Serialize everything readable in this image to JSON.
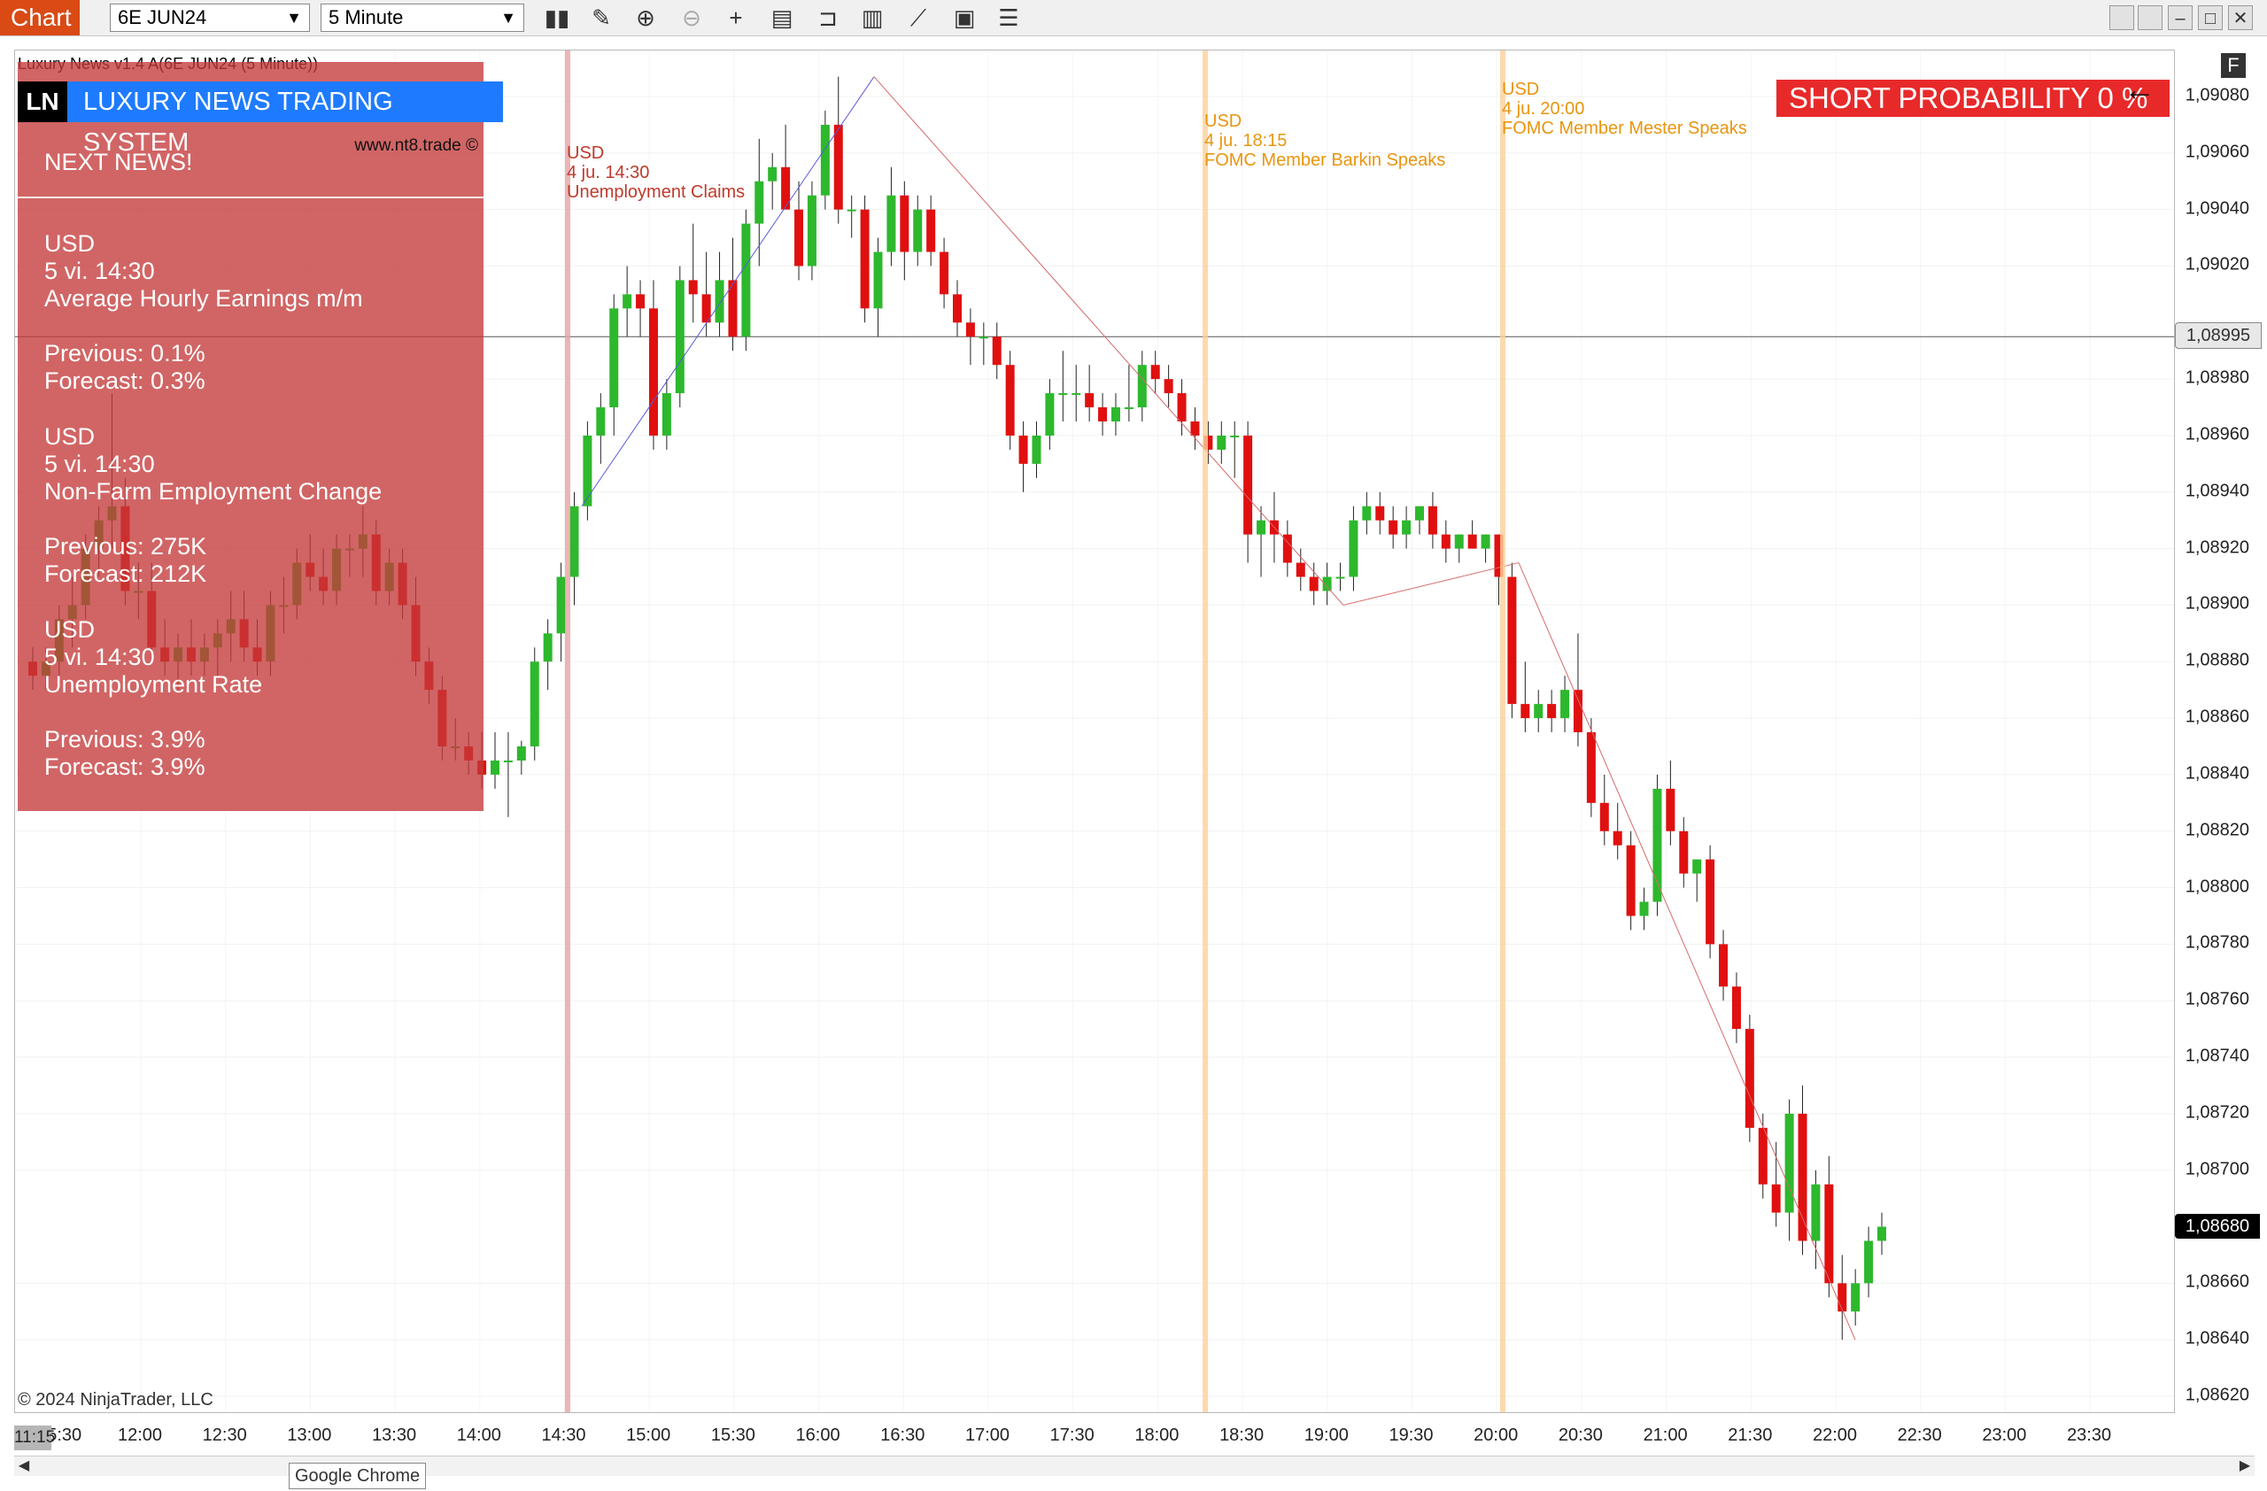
{
  "toolbar": {
    "chart_tab": "Chart",
    "instrument": "6E JUN24",
    "interval": "5 Minute",
    "icons": [
      "bar-type-icon",
      "draw-pencil-icon",
      "zoom-in-icon",
      "zoom-out-icon",
      "crosshair-icon",
      "data-box-icon",
      "order-ticket-icon",
      "strategy-icon",
      "indicator-icon",
      "properties-icon",
      "list-icon"
    ]
  },
  "indicator_title": "Luxury News v1.4 A(6E JUN24 (5 Minute))",
  "news_panel": {
    "logo": "LN",
    "brand": "LUXURY NEWS TRADING SYSTEM",
    "site": "www.nt8.trade ©",
    "next_title": "NEXT NEWS!",
    "items": [
      {
        "currency": "USD",
        "time": "5 vi. 14:30",
        "name": "Average Hourly Earnings m/m",
        "previous": "Previous: 0.1%",
        "forecast": "Forecast: 0.3%"
      },
      {
        "currency": "USD",
        "time": "5 vi. 14:30",
        "name": "Non-Farm Employment Change",
        "previous": "Previous: 275K",
        "forecast": "Forecast: 212K"
      },
      {
        "currency": "USD",
        "time": "5 vi. 14:30",
        "name": "Unemployment Rate",
        "previous": "Previous: 3.9%",
        "forecast": "Forecast: 3.9%"
      }
    ]
  },
  "probability_box": "SHORT PROBABILITY 0 %",
  "news_lines": [
    {
      "currency": "USD",
      "time": "4 ju. 14:30",
      "name": "Unemployment Claims",
      "color": "#c0392b"
    },
    {
      "currency": "USD",
      "time": "4 ju. 18:15",
      "name": "FOMC Member Barkin Speaks",
      "color": "#e8950f"
    },
    {
      "currency": "USD",
      "time": "4 ju. 20:00",
      "name": "FOMC Member Mester Speaks",
      "color": "#e8950f"
    }
  ],
  "chart_data": {
    "type": "candlestick",
    "instrument": "6E JUN24",
    "interval": "5 Minute",
    "y_ticks": [
      "1,09080",
      "1,09060",
      "1,09040",
      "1,09020",
      "1,08980",
      "1,08960",
      "1,08940",
      "1,08920",
      "1,08900",
      "1,08880",
      "1,08860",
      "1,08840",
      "1,08820",
      "1,08800",
      "1,08780",
      "1,08760",
      "1,08740",
      "1,08720",
      "1,08700",
      "1,08660",
      "1,08640",
      "1,08620"
    ],
    "y_range": [
      1.0862,
      1.0908
    ],
    "horizontal_line": "1,08995",
    "last_price": "1,08680",
    "x_ticks": [
      "12:00",
      "12:30",
      "13:00",
      "13:30",
      "14:00",
      "14:30",
      "15:00",
      "15:30",
      "16:00",
      "16:30",
      "17:00",
      "17:30",
      "18:00",
      "18:30",
      "19:00",
      "19:30",
      "20:00",
      "20:30",
      "21:00",
      "21:30",
      "22:00",
      "22:30",
      "23:00",
      "23:30"
    ],
    "x_first_label": "11:15:30",
    "up_color": "#2db82d",
    "down_color": "#e01010",
    "candles": [
      [
        1.0888,
        1.08885,
        1.0887,
        1.08875
      ],
      [
        1.08875,
        1.08885,
        1.0887,
        1.0888
      ],
      [
        1.0888,
        1.089,
        1.0887,
        1.08895
      ],
      [
        1.08895,
        1.0891,
        1.08885,
        1.089
      ],
      [
        1.089,
        1.08925,
        1.08895,
        1.0892
      ],
      [
        1.0892,
        1.08935,
        1.0891,
        1.0893
      ],
      [
        1.0893,
        1.08975,
        1.0892,
        1.08935
      ],
      [
        1.08935,
        1.08945,
        1.089,
        1.08905
      ],
      [
        1.08905,
        1.08915,
        1.08895,
        1.08905
      ],
      [
        1.08905,
        1.08915,
        1.0888,
        1.08885
      ],
      [
        1.08885,
        1.08895,
        1.08875,
        1.0888
      ],
      [
        1.0888,
        1.0889,
        1.0887,
        1.08885
      ],
      [
        1.08885,
        1.08895,
        1.08875,
        1.0888
      ],
      [
        1.0888,
        1.0889,
        1.08875,
        1.08885
      ],
      [
        1.08885,
        1.08895,
        1.08875,
        1.0889
      ],
      [
        1.0889,
        1.08905,
        1.0888,
        1.08895
      ],
      [
        1.08895,
        1.08905,
        1.0888,
        1.08885
      ],
      [
        1.08885,
        1.08895,
        1.08875,
        1.0888
      ],
      [
        1.0888,
        1.08905,
        1.08875,
        1.089
      ],
      [
        1.089,
        1.0891,
        1.0889,
        1.089
      ],
      [
        1.089,
        1.0892,
        1.08895,
        1.08915
      ],
      [
        1.08915,
        1.08925,
        1.08905,
        1.0891
      ],
      [
        1.0891,
        1.0892,
        1.089,
        1.08905
      ],
      [
        1.08905,
        1.08925,
        1.089,
        1.0892
      ],
      [
        1.0892,
        1.08925,
        1.0891,
        1.0892
      ],
      [
        1.0892,
        1.08935,
        1.0891,
        1.08925
      ],
      [
        1.08925,
        1.0893,
        1.089,
        1.08905
      ],
      [
        1.08905,
        1.0892,
        1.089,
        1.08915
      ],
      [
        1.08915,
        1.0892,
        1.08895,
        1.089
      ],
      [
        1.089,
        1.0891,
        1.08875,
        1.0888
      ],
      [
        1.0888,
        1.08885,
        1.08865,
        1.0887
      ],
      [
        1.0887,
        1.08875,
        1.08845,
        1.0885
      ],
      [
        1.0885,
        1.0886,
        1.08845,
        1.0885
      ],
      [
        1.0885,
        1.08855,
        1.0884,
        1.08845
      ],
      [
        1.08845,
        1.08855,
        1.08835,
        1.0884
      ],
      [
        1.0884,
        1.08855,
        1.08835,
        1.08845
      ],
      [
        1.08845,
        1.08855,
        1.08825,
        1.08845
      ],
      [
        1.08845,
        1.08852,
        1.0884,
        1.0885
      ],
      [
        1.0885,
        1.08885,
        1.08845,
        1.0888
      ],
      [
        1.0888,
        1.08895,
        1.0887,
        1.0889
      ],
      [
        1.0889,
        1.08915,
        1.0888,
        1.0891
      ],
      [
        1.0891,
        1.0894,
        1.089,
        1.08935
      ],
      [
        1.08935,
        1.08965,
        1.0893,
        1.0896
      ],
      [
        1.0896,
        1.08975,
        1.0895,
        1.0897
      ],
      [
        1.0897,
        1.0901,
        1.0896,
        1.09005
      ],
      [
        1.09005,
        1.0902,
        1.08995,
        1.0901
      ],
      [
        1.0901,
        1.09015,
        1.08995,
        1.09005
      ],
      [
        1.09005,
        1.09015,
        1.08955,
        1.0896
      ],
      [
        1.0896,
        1.0898,
        1.08955,
        1.08975
      ],
      [
        1.08975,
        1.0902,
        1.0897,
        1.09015
      ],
      [
        1.09015,
        1.09035,
        1.09,
        1.0901
      ],
      [
        1.0901,
        1.09025,
        1.08995,
        1.09
      ],
      [
        1.09,
        1.09025,
        1.08995,
        1.09015
      ],
      [
        1.09015,
        1.0903,
        1.0899,
        1.08995
      ],
      [
        1.08995,
        1.0904,
        1.0899,
        1.09035
      ],
      [
        1.09035,
        1.09065,
        1.0902,
        1.0905
      ],
      [
        1.0905,
        1.0906,
        1.0904,
        1.09055
      ],
      [
        1.09055,
        1.0907,
        1.09045,
        1.0904
      ],
      [
        1.0904,
        1.0905,
        1.09015,
        1.0902
      ],
      [
        1.0902,
        1.0905,
        1.09015,
        1.09045
      ],
      [
        1.09045,
        1.09075,
        1.0904,
        1.0907
      ],
      [
        1.0907,
        1.09087,
        1.09035,
        1.0904
      ],
      [
        1.0904,
        1.09045,
        1.0903,
        1.0904
      ],
      [
        1.0904,
        1.09045,
        1.09,
        1.09005
      ],
      [
        1.09005,
        1.0903,
        1.08995,
        1.09025
      ],
      [
        1.09025,
        1.09055,
        1.0902,
        1.09045
      ],
      [
        1.09045,
        1.0905,
        1.09015,
        1.09025
      ],
      [
        1.09025,
        1.09045,
        1.0902,
        1.0904
      ],
      [
        1.0904,
        1.09045,
        1.0902,
        1.09025
      ],
      [
        1.09025,
        1.0903,
        1.09005,
        1.0901
      ],
      [
        1.0901,
        1.09015,
        1.08995,
        1.09
      ],
      [
        1.09,
        1.09005,
        1.08985,
        1.08995
      ],
      [
        1.08995,
        1.09,
        1.08985,
        1.08995
      ],
      [
        1.08995,
        1.09,
        1.0898,
        1.08985
      ],
      [
        1.08985,
        1.0899,
        1.08955,
        1.0896
      ],
      [
        1.0896,
        1.08965,
        1.0894,
        1.0895
      ],
      [
        1.0895,
        1.08965,
        1.08945,
        1.0896
      ],
      [
        1.0896,
        1.0898,
        1.08955,
        1.08975
      ],
      [
        1.08975,
        1.0899,
        1.08965,
        1.08975
      ],
      [
        1.08975,
        1.08985,
        1.08965,
        1.08975
      ],
      [
        1.08975,
        1.08985,
        1.08965,
        1.0897
      ],
      [
        1.0897,
        1.08975,
        1.0896,
        1.08965
      ],
      [
        1.08965,
        1.08975,
        1.0896,
        1.0897
      ],
      [
        1.0897,
        1.08985,
        1.08965,
        1.0897
      ],
      [
        1.0897,
        1.0899,
        1.08965,
        1.08985
      ],
      [
        1.08985,
        1.0899,
        1.08975,
        1.0898
      ],
      [
        1.0898,
        1.08985,
        1.0897,
        1.08975
      ],
      [
        1.08975,
        1.0898,
        1.0896,
        1.08965
      ],
      [
        1.08965,
        1.0897,
        1.08955,
        1.0896
      ],
      [
        1.0896,
        1.08965,
        1.0895,
        1.08955
      ],
      [
        1.08955,
        1.08965,
        1.0895,
        1.0896
      ],
      [
        1.0896,
        1.08965,
        1.08945,
        1.0896
      ],
      [
        1.0896,
        1.08965,
        1.08915,
        1.08925
      ],
      [
        1.08925,
        1.08935,
        1.0891,
        1.0893
      ],
      [
        1.0893,
        1.0894,
        1.08915,
        1.08925
      ],
      [
        1.08925,
        1.0893,
        1.0891,
        1.08915
      ],
      [
        1.08915,
        1.0892,
        1.08905,
        1.0891
      ],
      [
        1.0891,
        1.08915,
        1.089,
        1.08905
      ],
      [
        1.08905,
        1.08915,
        1.089,
        1.0891
      ],
      [
        1.0891,
        1.08915,
        1.08905,
        1.0891
      ],
      [
        1.0891,
        1.08935,
        1.08905,
        1.0893
      ],
      [
        1.0893,
        1.0894,
        1.08925,
        1.08935
      ],
      [
        1.08935,
        1.0894,
        1.08925,
        1.0893
      ],
      [
        1.0893,
        1.08935,
        1.0892,
        1.08925
      ],
      [
        1.08925,
        1.08935,
        1.0892,
        1.0893
      ],
      [
        1.0893,
        1.08935,
        1.08925,
        1.08935
      ],
      [
        1.08935,
        1.0894,
        1.0892,
        1.08925
      ],
      [
        1.08925,
        1.0893,
        1.08915,
        1.0892
      ],
      [
        1.0892,
        1.08925,
        1.08915,
        1.08925
      ],
      [
        1.08925,
        1.0893,
        1.0892,
        1.0892
      ],
      [
        1.0892,
        1.08925,
        1.08915,
        1.08925
      ],
      [
        1.08925,
        1.08925,
        1.089,
        1.0891
      ],
      [
        1.0891,
        1.08915,
        1.0886,
        1.08865
      ],
      [
        1.08865,
        1.0888,
        1.08855,
        1.0886
      ],
      [
        1.0886,
        1.0887,
        1.08855,
        1.08865
      ],
      [
        1.08865,
        1.0887,
        1.08855,
        1.0886
      ],
      [
        1.0886,
        1.08875,
        1.08855,
        1.0887
      ],
      [
        1.0887,
        1.0889,
        1.0885,
        1.08855
      ],
      [
        1.08855,
        1.0886,
        1.08825,
        1.0883
      ],
      [
        1.0883,
        1.0884,
        1.08815,
        1.0882
      ],
      [
        1.0882,
        1.0883,
        1.0881,
        1.08815
      ],
      [
        1.08815,
        1.0882,
        1.08785,
        1.0879
      ],
      [
        1.0879,
        1.088,
        1.08785,
        1.08795
      ],
      [
        1.08795,
        1.0884,
        1.0879,
        1.08835
      ],
      [
        1.08835,
        1.08845,
        1.08815,
        1.0882
      ],
      [
        1.0882,
        1.08825,
        1.088,
        1.08805
      ],
      [
        1.08805,
        1.0881,
        1.08795,
        1.0881
      ],
      [
        1.0881,
        1.08815,
        1.08775,
        1.0878
      ],
      [
        1.0878,
        1.08785,
        1.0876,
        1.08765
      ],
      [
        1.08765,
        1.0877,
        1.08745,
        1.0875
      ],
      [
        1.0875,
        1.08755,
        1.0871,
        1.08715
      ],
      [
        1.08715,
        1.0872,
        1.0869,
        1.08695
      ],
      [
        1.08695,
        1.0871,
        1.0868,
        1.08685
      ],
      [
        1.08685,
        1.08725,
        1.08675,
        1.0872
      ],
      [
        1.0872,
        1.0873,
        1.0867,
        1.08675
      ],
      [
        1.08675,
        1.087,
        1.08665,
        1.08695
      ],
      [
        1.08695,
        1.08705,
        1.08655,
        1.0866
      ],
      [
        1.0866,
        1.0867,
        1.0864,
        1.0865
      ],
      [
        1.0865,
        1.08665,
        1.08645,
        1.0866
      ],
      [
        1.0866,
        1.0868,
        1.08655,
        1.08675
      ],
      [
        1.08675,
        1.08685,
        1.0867,
        1.0868
      ]
    ]
  },
  "copyright": "© 2024 NinjaTrader, LLC",
  "time_stamp": "11:15",
  "tooltip": "Google Chrome",
  "f_button": "F"
}
